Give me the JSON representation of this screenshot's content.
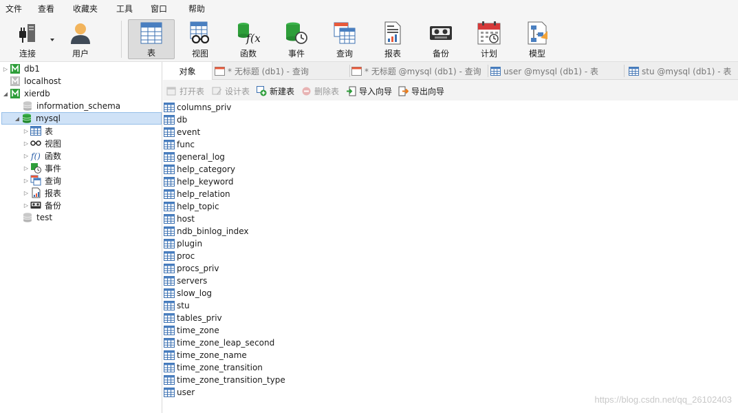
{
  "menu": [
    "文件",
    "查看",
    "收藏夹",
    "工具",
    "窗口",
    "帮助"
  ],
  "toolbar": {
    "connect": "连接",
    "user": "用户",
    "table": "表",
    "view": "视图",
    "function": "函数",
    "event": "事件",
    "query": "查询",
    "report": "报表",
    "backup": "备份",
    "schedule": "计划",
    "model": "模型"
  },
  "tree": {
    "connections": [
      "db1",
      "localhost",
      "xierdb"
    ],
    "databases": [
      "information_schema",
      "mysql",
      "test"
    ],
    "mysql_children": [
      "表",
      "视图",
      "函数",
      "事件",
      "查询",
      "报表",
      "备份"
    ]
  },
  "tabs": [
    "对象",
    "* 无标题 (db1) - 查询",
    "* 无标题 @mysql (db1) - 查询",
    "user @mysql (db1) - 表",
    "stu @mysql (db1) - 表"
  ],
  "object_toolbar": {
    "open": "打开表",
    "design": "设计表",
    "new": "新建表",
    "delete": "删除表",
    "import": "导入向导",
    "export": "导出向导"
  },
  "tables": [
    "columns_priv",
    "db",
    "event",
    "func",
    "general_log",
    "help_category",
    "help_keyword",
    "help_relation",
    "help_topic",
    "host",
    "ndb_binlog_index",
    "plugin",
    "proc",
    "procs_priv",
    "servers",
    "slow_log",
    "stu",
    "tables_priv",
    "time_zone",
    "time_zone_leap_second",
    "time_zone_name",
    "time_zone_transition",
    "time_zone_transition_type",
    "user"
  ],
  "watermark": "https://blog.csdn.net/qq_26102403",
  "colors": {
    "db_green": "#2e9e3a",
    "selection": "#cfe2f7",
    "table_icon_blue": "#4a7fc0"
  }
}
